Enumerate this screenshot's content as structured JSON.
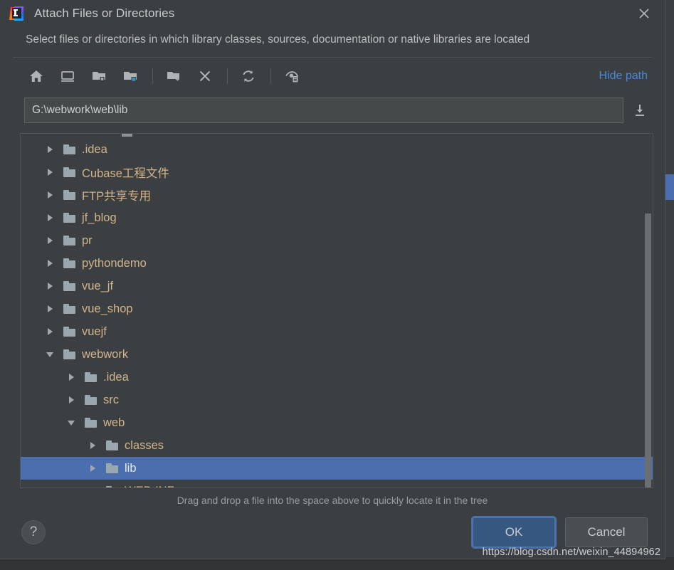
{
  "window": {
    "title": "Attach Files or Directories",
    "app_icon": "intellij-idea-logo",
    "close_icon": "close-icon",
    "subtitle": "Select files or directories in which library classes, sources, documentation or native libraries are located"
  },
  "toolbar": {
    "buttons": [
      {
        "name": "home-icon",
        "tooltip": "Home"
      },
      {
        "name": "desktop-icon",
        "tooltip": "Desktop"
      },
      {
        "name": "folder-module-icon",
        "tooltip": "Module directory"
      },
      {
        "name": "folder-project-icon",
        "tooltip": "Project directory"
      },
      {
        "name": "new-folder-icon",
        "tooltip": "New folder"
      },
      {
        "name": "delete-icon",
        "tooltip": "Delete"
      },
      {
        "name": "refresh-icon",
        "tooltip": "Refresh"
      },
      {
        "name": "show-hidden-files-icon",
        "tooltip": "Show hidden files and directories"
      }
    ],
    "hide_path_label": "Hide path"
  },
  "path": {
    "value": "G:\\webwork\\web\\lib",
    "placeholder": "",
    "import_icon": "import-arrow-icon"
  },
  "tree": {
    "rows": [
      {
        "label": ".idea",
        "indent": 1,
        "state": "collapsed",
        "selected": false
      },
      {
        "label": "Cubase工程文件",
        "indent": 1,
        "state": "collapsed",
        "selected": false
      },
      {
        "label": "FTP共享专用",
        "indent": 1,
        "state": "collapsed",
        "selected": false
      },
      {
        "label": "jf_blog",
        "indent": 1,
        "state": "collapsed",
        "selected": false
      },
      {
        "label": "pr",
        "indent": 1,
        "state": "collapsed",
        "selected": false
      },
      {
        "label": "pythondemo",
        "indent": 1,
        "state": "collapsed",
        "selected": false
      },
      {
        "label": "vue_jf",
        "indent": 1,
        "state": "collapsed",
        "selected": false
      },
      {
        "label": "vue_shop",
        "indent": 1,
        "state": "collapsed",
        "selected": false
      },
      {
        "label": "vuejf",
        "indent": 1,
        "state": "collapsed",
        "selected": false
      },
      {
        "label": "webwork",
        "indent": 1,
        "state": "expanded",
        "selected": false
      },
      {
        "label": ".idea",
        "indent": 2,
        "state": "collapsed",
        "selected": false
      },
      {
        "label": "src",
        "indent": 2,
        "state": "collapsed",
        "selected": false
      },
      {
        "label": "web",
        "indent": 2,
        "state": "expanded",
        "selected": false
      },
      {
        "label": "classes",
        "indent": 3,
        "state": "collapsed",
        "selected": false
      },
      {
        "label": "lib",
        "indent": 3,
        "state": "collapsed",
        "selected": true
      },
      {
        "label": "WEB-INF",
        "indent": 3,
        "state": "collapsed",
        "selected": false
      }
    ]
  },
  "hint": "Drag and drop a file into the space above to quickly locate it in the tree",
  "footer": {
    "help_label": "?",
    "ok_label": "OK",
    "cancel_label": "Cancel"
  },
  "watermark": "https://blog.csdn.net/weixin_44894962",
  "colors": {
    "dialog_bg": "#3c3f41",
    "selection_blue": "#4b6eaf",
    "link_blue": "#4a88d8",
    "primary_button": "#365880",
    "tree_label": "#d2b48c"
  }
}
